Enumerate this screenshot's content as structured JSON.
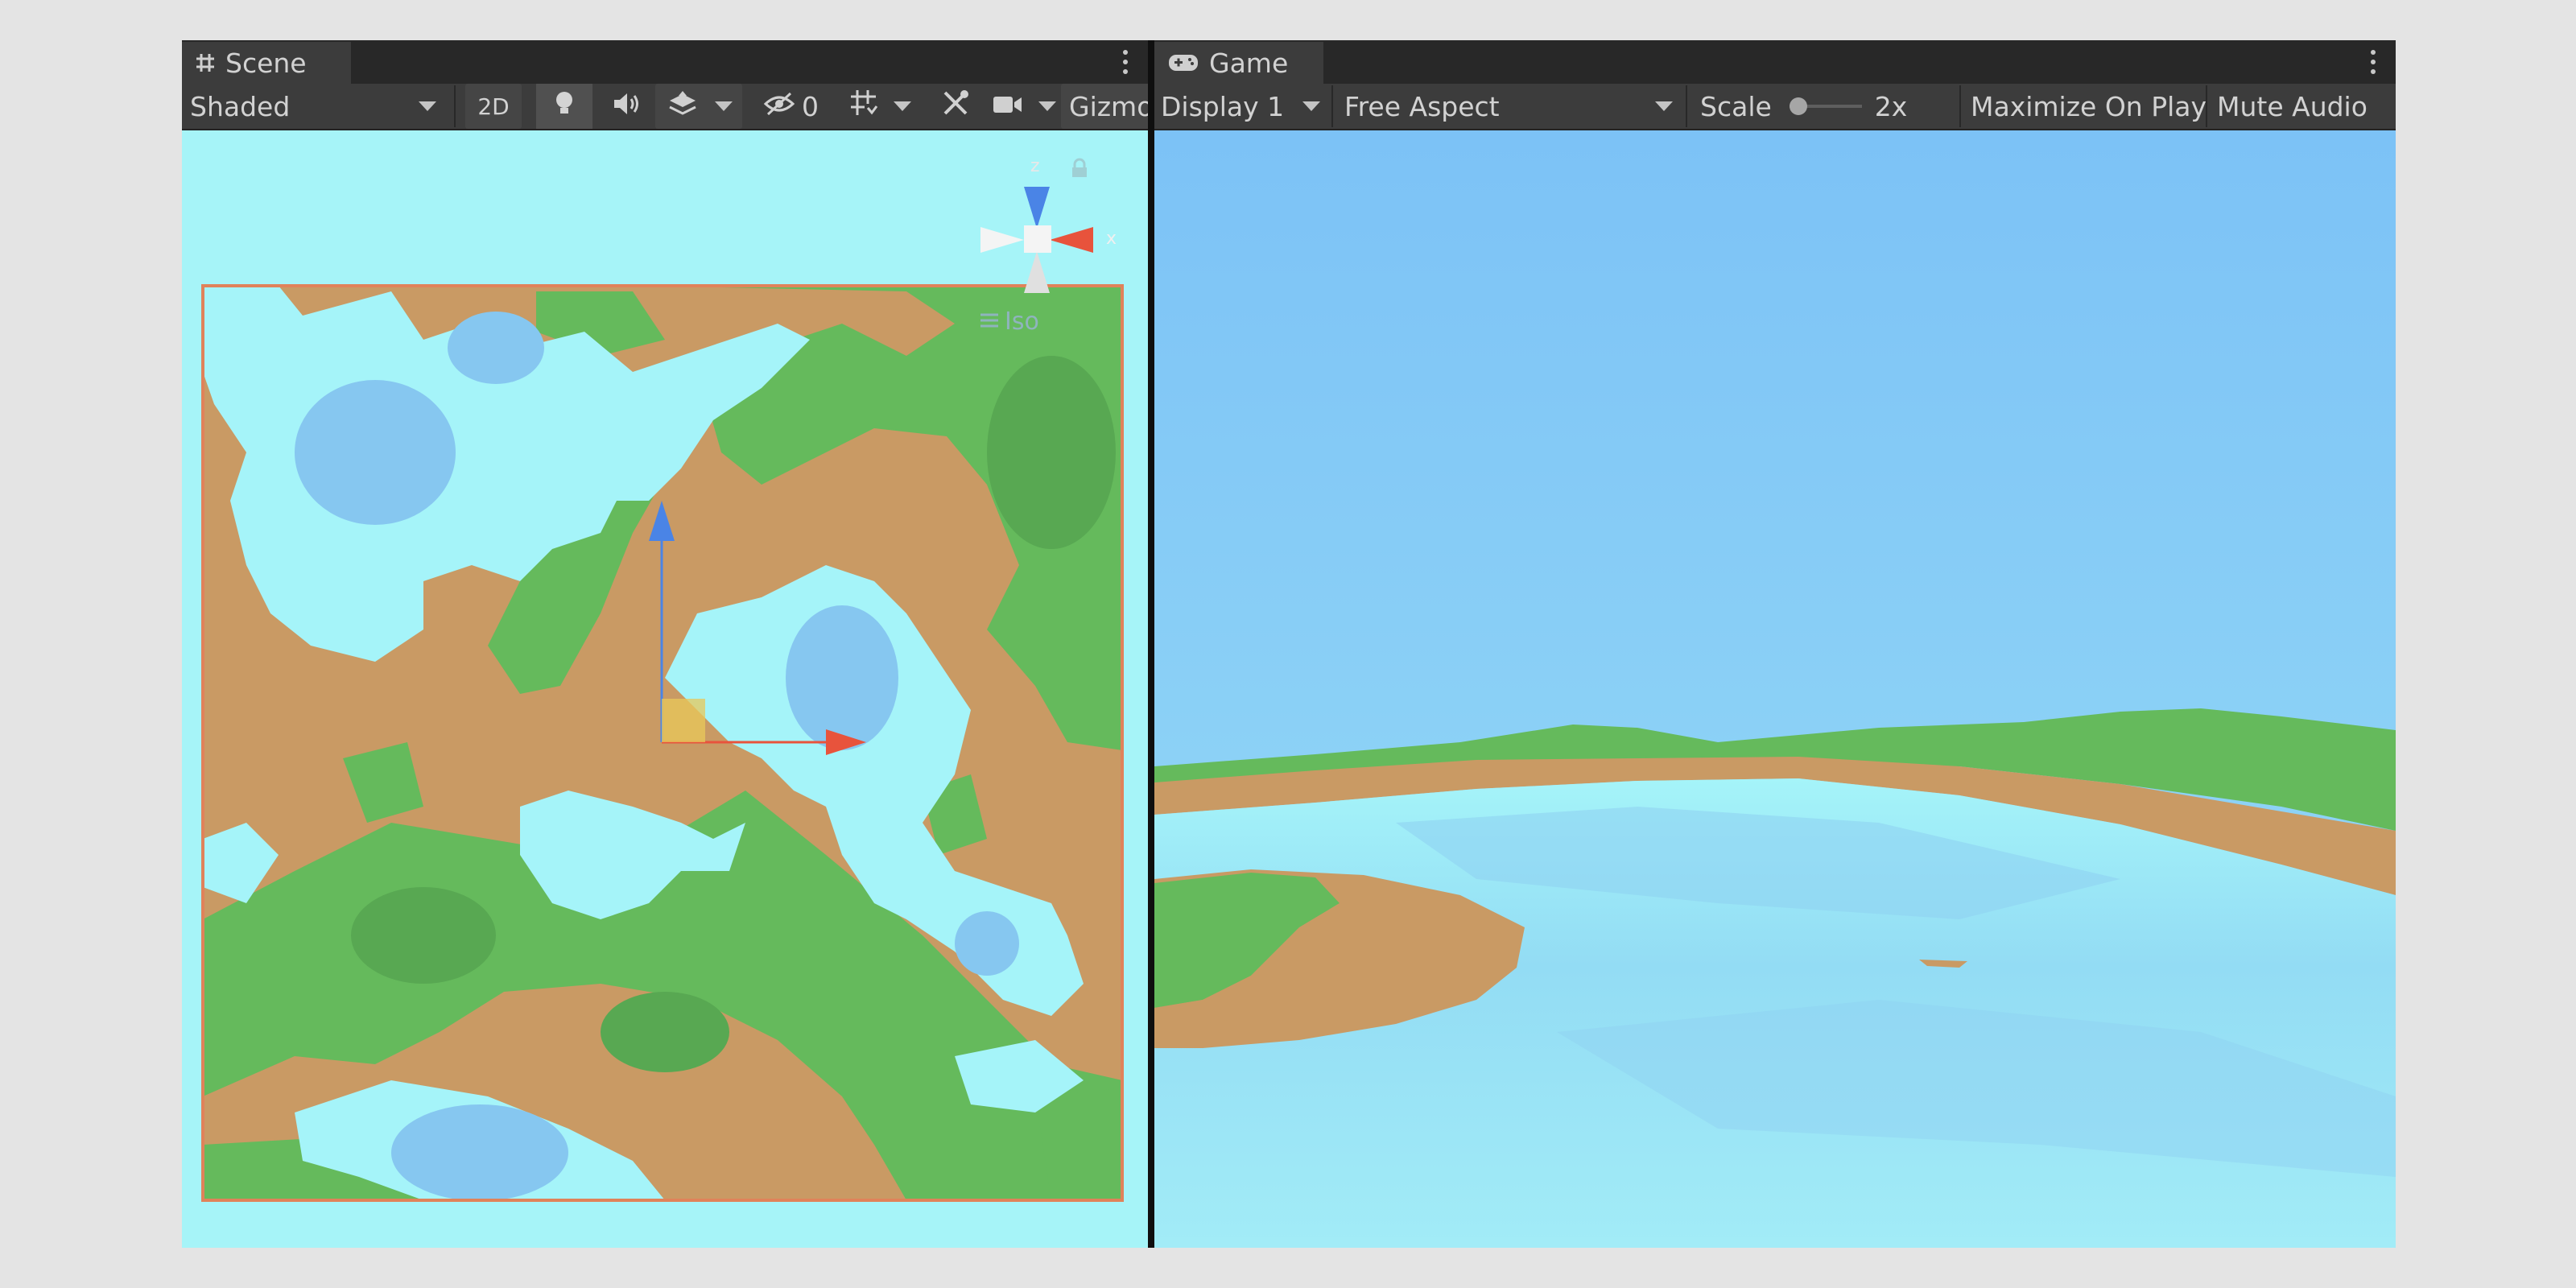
{
  "scene": {
    "tab_label": "Scene",
    "shading_mode": "Shaded",
    "toggle_2d": "2D",
    "hidden_count": "0",
    "gizmos_label": "Gizmos",
    "orientation": {
      "axis_x": "x",
      "axis_z": "z",
      "projection": "Iso"
    }
  },
  "game": {
    "tab_label": "Game",
    "display": "Display 1",
    "aspect": "Free Aspect",
    "scale_label": "Scale",
    "scale_value": "2x",
    "scale_slider_value": 0.0,
    "maximize_label": "Maximize On Play",
    "mute_label": "Mute Audio"
  },
  "colors": {
    "sky": "#7fc4f5",
    "water_light": "#a5f4f9",
    "water_deep": "#86c7f0",
    "grass": "#65ba5c",
    "sand": "#c99a64",
    "axis_x": "#e8533c",
    "axis_z": "#4a84e6",
    "ui_panel": "#3c3c3c",
    "ui_tabbar": "#282828"
  }
}
